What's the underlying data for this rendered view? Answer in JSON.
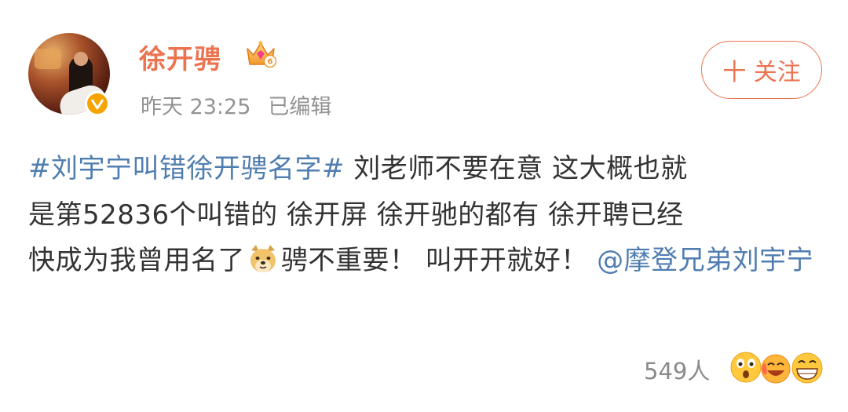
{
  "post": {
    "user": {
      "name": "徐开骋",
      "avatar_icon": "avatar-photo",
      "badge_icon": "crown-vip-icon",
      "badge_level": "6",
      "verified_icon": "verified-v-icon"
    },
    "meta": {
      "time": "昨天 23:25",
      "edited": "已编辑"
    },
    "follow_button": "十 关注",
    "content": {
      "topic": "#刘宇宁叫错徐开骋名字#",
      "text_line1": " 刘老师不要在意 这大概也就",
      "text_line2": "是第52836个叫错的 徐开屏 徐开驰的都有 徐开聘已经",
      "text_line3": "快成为我曾用名了",
      "emoji_icon": "doge-emoji-icon",
      "text_line3b": "骋不重要！ 叫开开就好！",
      "mention": "@摩登兄弟刘宇宁"
    },
    "footer": {
      "likes": "549人",
      "reaction_icons": [
        "shocked-emoji-icon",
        "laughing-emoji-icon",
        "grin-emoji-icon"
      ]
    },
    "colors": {
      "accent": "#eb7350",
      "link": "#507daf",
      "text": "#333333",
      "meta": "#939393"
    }
  }
}
